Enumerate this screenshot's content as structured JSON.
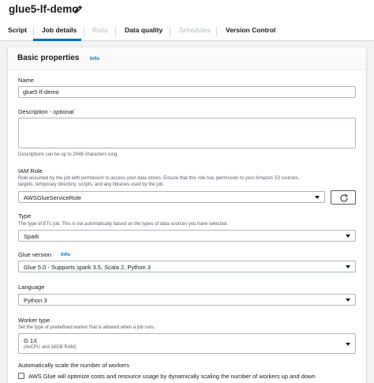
{
  "header": {
    "title": "glue5-lf-demo"
  },
  "tabs": [
    {
      "label": "Script",
      "disabled": false
    },
    {
      "label": "Job details",
      "active": true
    },
    {
      "label": "Runs",
      "disabled": true
    },
    {
      "label": "Data quality",
      "disabled": false
    },
    {
      "label": "Schedules",
      "disabled": true
    },
    {
      "label": "Version Control",
      "disabled": false
    }
  ],
  "basic_properties": {
    "title": "Basic properties",
    "info": "Info"
  },
  "name": {
    "label": "Name",
    "value": "glue5-lf-demo"
  },
  "description": {
    "label": "Description",
    "optional": "optional",
    "value": "",
    "hint": "Descriptions can be up to 2048 characters long."
  },
  "iam_role": {
    "label": "IAM Role",
    "desc_line1": "Role assumed by the job with permission to access your data stores. Ensure that this role has permission to your Amazon S3 sources,",
    "desc_line2": "targets, temporary directory, scripts, and any libraries used by the job.",
    "value": "AWSGlueServiceRole"
  },
  "type": {
    "label": "Type",
    "desc": "The type of ETL job. This is set automatically based on the types of data sources you have selected.",
    "value": "Spark"
  },
  "glue_version": {
    "label": "Glue version",
    "info": "Info",
    "value": "Glue 5.0 - Supports spark 3.5, Scala 2, Python 3"
  },
  "language": {
    "label": "Language",
    "value": "Python 3"
  },
  "worker_type": {
    "label": "Worker type",
    "desc": "Set the type of predefined worker that is allowed when a job runs.",
    "value": "G 1X",
    "value_detail": "(4vCPU and 16GB RAM)"
  },
  "autoscale": {
    "label": "Automatically scale the number of workers",
    "checkbox_text": "AWS Glue will optimize costs and resource usage by dynamically scaling the number of workers up and down",
    "checked": false
  },
  "colors": {
    "accent": "#0073bb",
    "disabled": "#aab7b8"
  }
}
